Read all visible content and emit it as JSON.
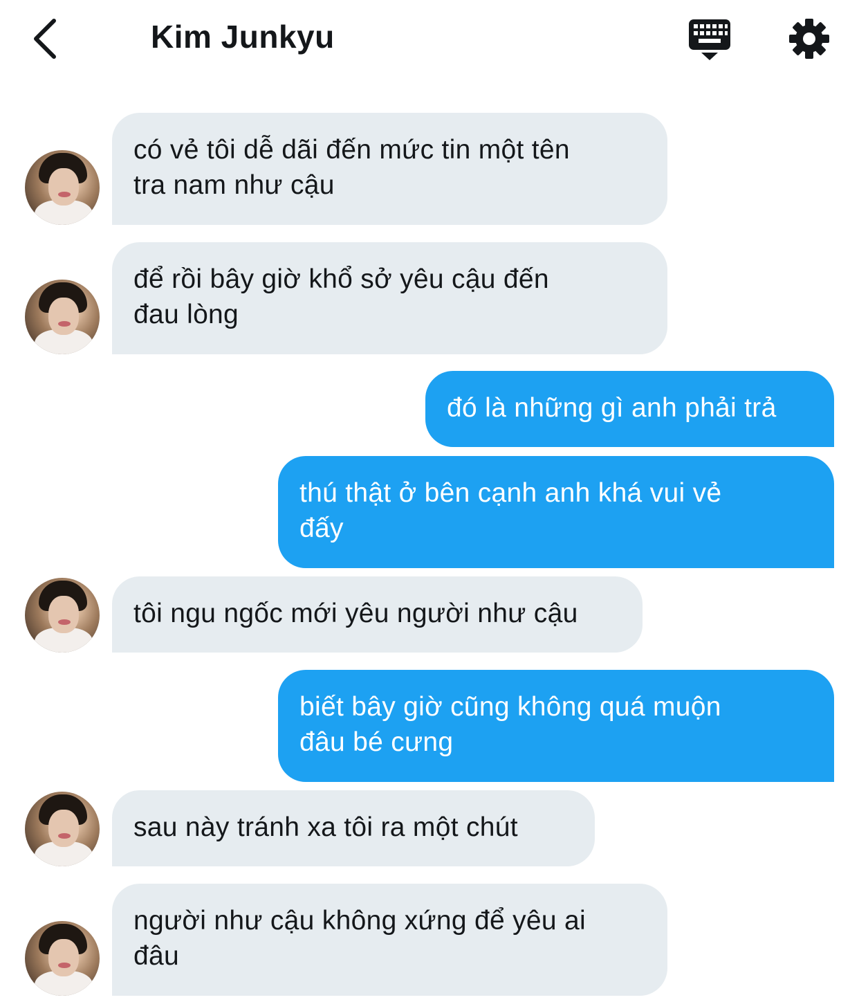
{
  "header": {
    "back_icon": "chevron-left-icon",
    "title": "Kim Junkyu",
    "keyboard_icon": "keyboard-icon",
    "settings_icon": "gear-icon"
  },
  "colors": {
    "incoming_bubble": "#e6ecf0",
    "outgoing_bubble": "#1da1f2",
    "text_dark": "#14171a"
  },
  "messages": [
    {
      "direction": "incoming",
      "text": "có vẻ tôi dễ dãi đến mức tin một tên\ntra nam như cậu"
    },
    {
      "direction": "incoming",
      "text": "để rồi bây giờ khổ sở yêu cậu đến\nđau lòng"
    },
    {
      "direction": "outgoing",
      "text": "đó là những gì anh phải trả"
    },
    {
      "direction": "outgoing",
      "text": "thú thật ở bên cạnh anh khá vui vẻ\nđấy"
    },
    {
      "direction": "incoming",
      "text": "tôi ngu ngốc mới yêu người như cậu"
    },
    {
      "direction": "outgoing",
      "text": "biết bây giờ cũng không quá muộn\nđâu bé cưng"
    },
    {
      "direction": "incoming",
      "text": "sau này tránh xa tôi ra một chút"
    },
    {
      "direction": "incoming",
      "text": "người như cậu không xứng để yêu ai\nđâu"
    }
  ]
}
